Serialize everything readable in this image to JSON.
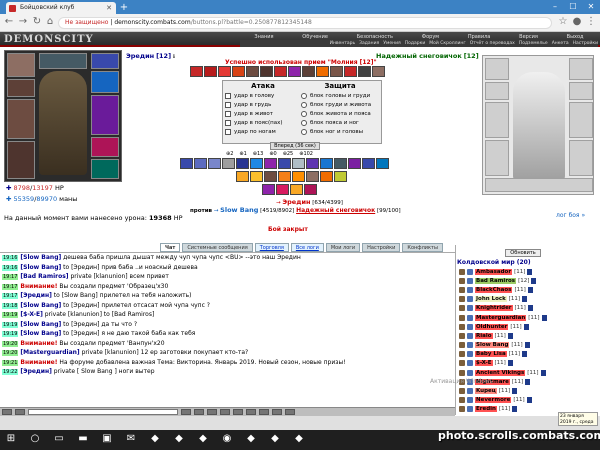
{
  "browser": {
    "tab_title": "Бойцовский клуб",
    "not_secure": "Не защищено",
    "url_domain": "demonscity.combats.com",
    "url_path": "/buttons.pl?battle=0.250877812345148"
  },
  "game": {
    "logo": "DEMONSCITY",
    "top_links": [
      "Знания",
      "Обучение",
      "Безопасность",
      "Форум",
      "Правила",
      "Версия",
      "Выход"
    ],
    "menu": [
      "Инвентарь",
      "Задания",
      "Умения",
      "Подарки",
      "Мой Скроллинг",
      "Отчёт о переводах",
      "Подземелье",
      "Анкета",
      "Настройки"
    ]
  },
  "player": {
    "name": "Эредин",
    "level": "[12]",
    "hp_cur": "8798",
    "hp_max": "13197",
    "hp_unit": "HP",
    "mp_cur": "55359",
    "mp_max": "89970",
    "mp_unit": "маны",
    "damage_label": "На данный момент вами нанесено урона:",
    "damage_value": "19368",
    "damage_unit": "HP"
  },
  "enemy": {
    "name": "Надежный снеговичок",
    "level": "[12]",
    "log_link": "лог боя »"
  },
  "battle": {
    "success_msg": "Успешно использован прием \"Молния [12]\"",
    "attack_header": "Атака",
    "defense_header": "Защита",
    "attacks": [
      "удар в голову",
      "удар в грудь",
      "удар в живот",
      "удар в пояс(пах)",
      "удар по ногам"
    ],
    "defenses": [
      "блок головы и груди",
      "блок груди и живота",
      "блок живота и пояса",
      "блок пояса и ног",
      "блок ног и головы"
    ],
    "forward_btn": "Вперед (36 сек)",
    "counters": [
      "⊕2",
      "⊕1",
      "⊕13",
      "⊕0",
      "⊕25",
      "⊕102"
    ],
    "target_name": "Эредин",
    "target_hp": "[634/4399]",
    "vs_label": "против",
    "vs_player": "Slow Bang",
    "vs_player_hp": "[4519/8902]",
    "vs_enemy": "Надежный снеговичок",
    "vs_enemy_hp": "[99/100]",
    "battle_closed": "Бой закрыт"
  },
  "chat_tabs": [
    "Чат",
    "Системные сообщения",
    "Торговля",
    "Все логи",
    "Мои логи",
    "Настройки",
    "Конфликты"
  ],
  "chat": [
    {
      "time": "19:16",
      "green": false,
      "nick": "[Slow Bang]",
      "text": "дешева баба пришла дышат между чуп чупа чупс <BU> --это наш Эредин"
    },
    {
      "time": "19:16",
      "green": false,
      "nick": "[Slow Bang]",
      "text": "to [Эредин] прив баба ..и ноаскый дешева"
    },
    {
      "time": "19:17",
      "green": true,
      "nick": "[Bad Ramiros]",
      "text": "private [klanunion] всем привет"
    },
    {
      "time": "19:17",
      "green": true,
      "nick": "Внимание!",
      "text": "Вы создали предмет 'Образец'x30"
    },
    {
      "time": "19:17",
      "green": false,
      "nick": "[Эредин]",
      "text": "to [Slow Bang] прилетел на тебя наложить)"
    },
    {
      "time": "19:18",
      "green": false,
      "nick": "[Slow Bang]",
      "text": "to [Эредин] прилетел отсасат мой чупа чупс ?"
    },
    {
      "time": "19:19",
      "green": true,
      "nick": "[$-X-E]",
      "text": "private [klanunion] to [Bad Ramiros]"
    },
    {
      "time": "19:19",
      "green": false,
      "nick": "[Slow Bang]",
      "text": "to [Эредин] да ты что ?"
    },
    {
      "time": "19:19",
      "green": false,
      "nick": "[Slow Bang]",
      "text": "to [Эредин] я не даю такой баба как тебя"
    },
    {
      "time": "19:20",
      "green": true,
      "nick": "Внимание!",
      "text": "Вы создали предмет 'Ванпун'x20"
    },
    {
      "time": "19:20",
      "green": true,
      "nick": "[Masterguardian]",
      "text": "private [klanunion] 12 ер заготовки покупает кто-та?"
    },
    {
      "time": "19:21",
      "green": true,
      "nick": "Внимание!",
      "text": "На форуме добавлена важная Тема: Викторина. Январь 2019. Новый сезон, новые призы!"
    },
    {
      "time": "19:22",
      "green": false,
      "nick": "[Эредин]",
      "text": "private [ Slow Bang ] ноги вытер"
    }
  ],
  "online": {
    "refresh_btn": "Обновить",
    "header": "Колдовской мир (20)",
    "users": [
      {
        "name": "Ambasador",
        "lvl": "[11]"
      },
      {
        "name": "Bad Ramiros",
        "lvl": "[12]"
      },
      {
        "name": "BlackChaos",
        "lvl": "[11]"
      },
      {
        "name": "John Lock",
        "lvl": "[11]"
      },
      {
        "name": "Knightrider",
        "lvl": "[11]"
      },
      {
        "name": "Masterguardian",
        "lvl": "[11]"
      },
      {
        "name": "Oldhunter",
        "lvl": "[11]"
      },
      {
        "name": "Rialo",
        "lvl": "[11]"
      },
      {
        "name": "Slow Bang",
        "lvl": "[11]"
      },
      {
        "name": "Baby Lisa",
        "lvl": "[11]"
      },
      {
        "name": "$-X-E",
        "lvl": "[11]"
      },
      {
        "name": "Ancient Vikings",
        "lvl": "[11]"
      },
      {
        "name": "Nightmare",
        "lvl": "[11]"
      },
      {
        "name": "Kupeц",
        "lvl": "[11]"
      },
      {
        "name": "Nevermore",
        "lvl": "[11]"
      },
      {
        "name": "Eredin",
        "lvl": "[11]"
      },
      {
        "name": "Skogg",
        "lvl": "[11]"
      }
    ]
  },
  "overlay": {
    "activate": "Активация Windows",
    "tooltip": "23 января 2019 г., среда",
    "watermark": "photo.scrolls.combats.com"
  },
  "colors": {
    "chrome_blue": "#3c82c4",
    "accent_red": "#8a0000",
    "name_blue": "#00008b",
    "chat_time": "#7fffd4"
  }
}
